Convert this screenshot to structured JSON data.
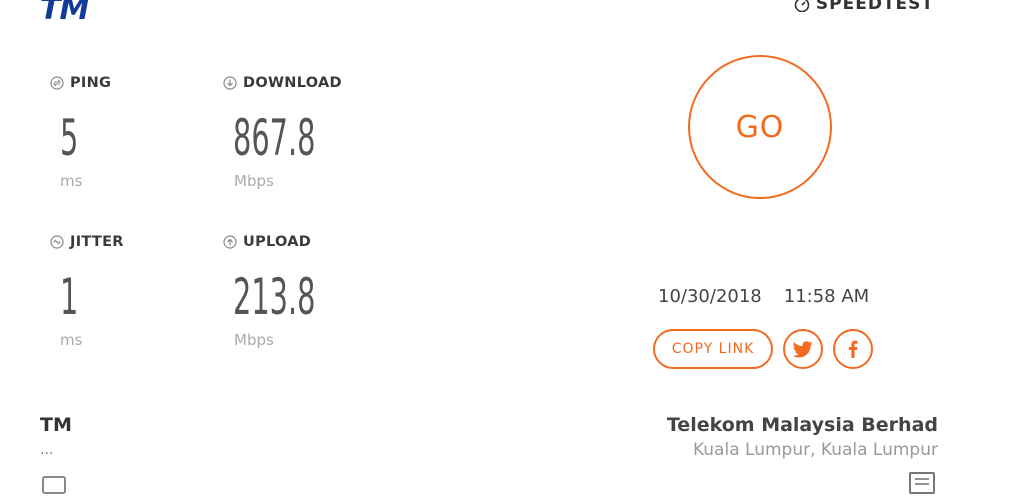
{
  "header": {
    "logo_text": "TM",
    "brand_text": "SPEEDTEST",
    "logo_color": "#123a9a",
    "accent_color": "#f26b21"
  },
  "metrics": {
    "ping": {
      "label": "PING",
      "value": "5",
      "unit": "ms",
      "icon": "ping-icon"
    },
    "download": {
      "label": "DOWNLOAD",
      "value": "867.8",
      "unit": "Mbps",
      "icon": "download-icon"
    },
    "jitter": {
      "label": "JITTER",
      "value": "1",
      "unit": "ms",
      "icon": "jitter-icon"
    },
    "upload": {
      "label": "UPLOAD",
      "value": "213.8",
      "unit": "Mbps",
      "icon": "upload-icon"
    }
  },
  "go_button": {
    "label": "GO"
  },
  "result": {
    "date": "10/30/2018",
    "time": "11:58 AM",
    "copy_link_label": "COPY LINK",
    "share_icons": [
      "twitter-icon",
      "facebook-icon"
    ]
  },
  "isp": {
    "name": "TM",
    "ip": "..."
  },
  "server": {
    "name": "Telekom Malaysia Berhad",
    "location": "Kuala Lumpur, Kuala Lumpur"
  }
}
